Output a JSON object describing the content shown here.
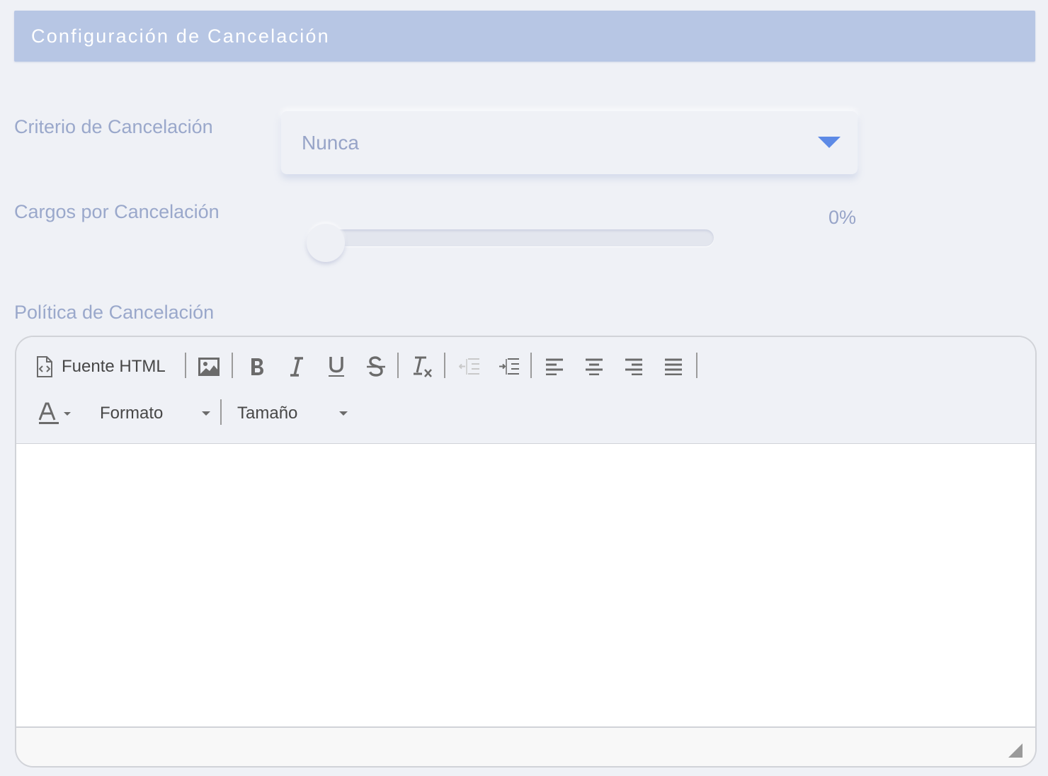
{
  "header": {
    "title": "Configuración de Cancelación"
  },
  "criterio": {
    "label": "Criterio de Cancelación",
    "selected": "Nunca"
  },
  "cargos": {
    "label": "Cargos por Cancelación",
    "value_text": "0%",
    "value": 0
  },
  "politica": {
    "label": "Política de Cancelación",
    "content": ""
  },
  "toolbar": {
    "source_label": "Fuente HTML",
    "format_label": "Formato",
    "size_label": "Tamaño",
    "icons": [
      "source-icon",
      "image-icon",
      "bold-icon",
      "italic-icon",
      "underline-icon",
      "strikethrough-icon",
      "remove-format-icon",
      "outdent-icon",
      "indent-icon",
      "align-left-icon",
      "align-center-icon",
      "align-right-icon",
      "align-justify-icon",
      "text-color-icon"
    ]
  },
  "colors": {
    "header_bg": "#b7c6e4",
    "accent": "#5d8ae6",
    "label": "#9aa8cb",
    "page_bg": "#eff1f6"
  }
}
